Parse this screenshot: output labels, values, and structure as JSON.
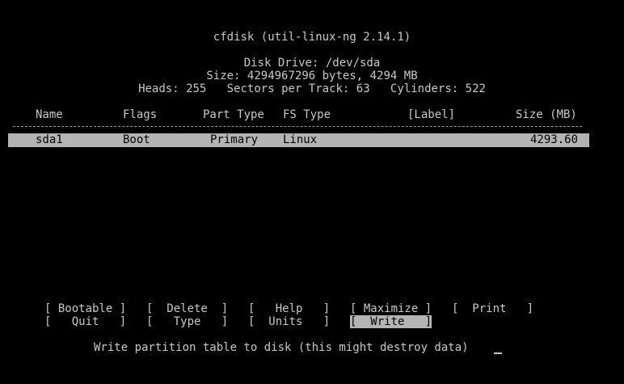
{
  "header": {
    "title": "cfdisk (util-linux-ng 2.14.1)",
    "disk_drive": "Disk Drive: /dev/sda",
    "size": "Size: 4294967296 bytes, 4294 MB",
    "geometry": "Heads: 255   Sectors per Track: 63   Cylinders: 522"
  },
  "table": {
    "columns": [
      "Name",
      "Flags",
      "Part Type",
      "FS Type",
      "[Label]",
      "Size (MB)"
    ],
    "rows": [
      {
        "name": "sda1",
        "flags": "Boot",
        "part_type": "Primary",
        "fs_type": "Linux",
        "label": "",
        "size": "4293.60"
      }
    ]
  },
  "menu": {
    "items": [
      {
        "label": "[ Bootable ]"
      },
      {
        "label": "[  Delete  ]"
      },
      {
        "label": "[   Help   ]"
      },
      {
        "label": "[ Maximize ]"
      },
      {
        "label": "[  Print   ]"
      },
      {
        "label": "[   Quit   ]"
      },
      {
        "label": "[   Type   ]"
      },
      {
        "label": "[  Units   ]"
      },
      {
        "label": "[  Write   ]"
      }
    ],
    "selected": "Write"
  },
  "status": "Write partition table to disk (this might destroy data)",
  "colors": {
    "background": "#000000",
    "text": "#c8c8c8",
    "highlight": "#b4b4b4"
  }
}
